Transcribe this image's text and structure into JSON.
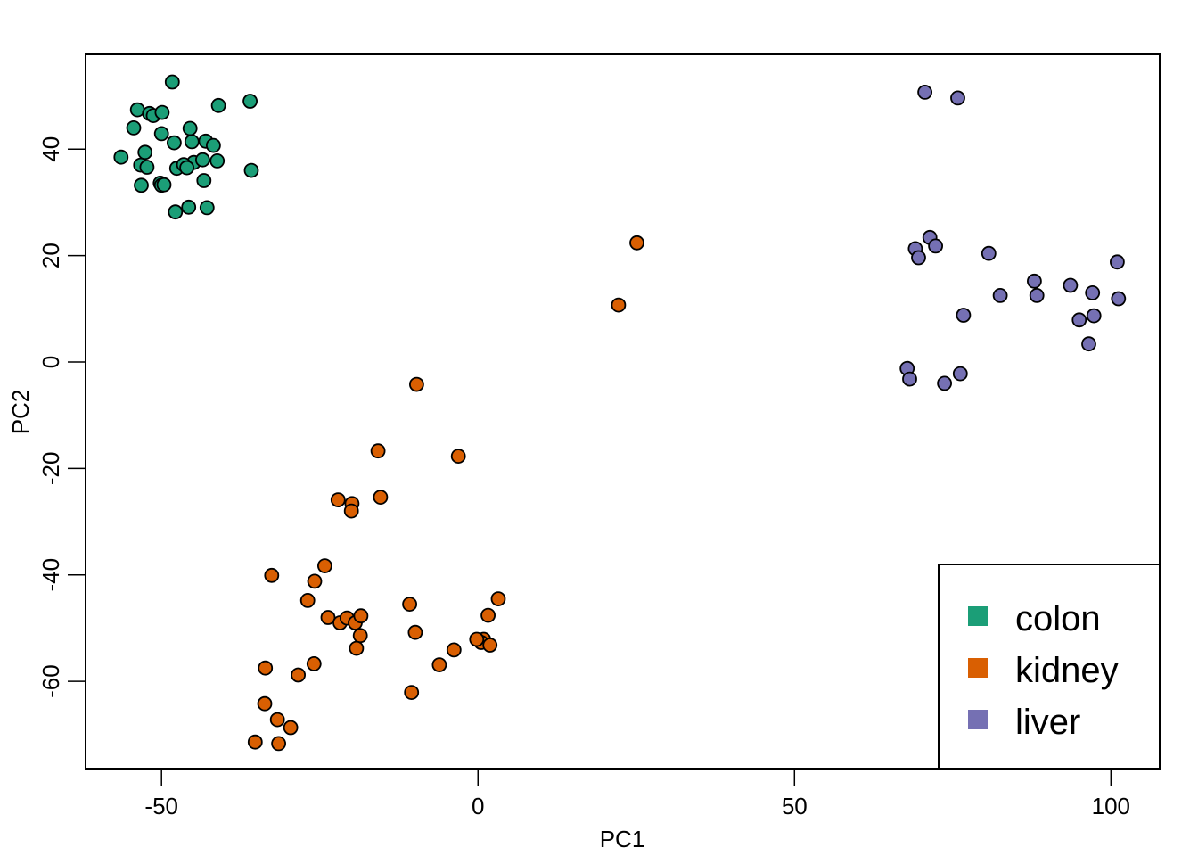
{
  "chart_data": {
    "type": "scatter",
    "title": "",
    "xlabel": "PC1",
    "ylabel": "PC2",
    "xlim": [
      -62.0,
      107.7
    ],
    "ylim": [
      -76.4,
      57.8
    ],
    "xticks": [
      -50,
      0,
      50,
      100
    ],
    "xtick_labels": [
      "-50",
      "0",
      "50",
      "100"
    ],
    "yticks": [
      -60,
      -40,
      -20,
      0,
      20,
      40
    ],
    "ytick_labels": [
      "-60",
      "-40",
      "-20",
      "0",
      "20",
      "40"
    ],
    "grid": false,
    "legend": {
      "position": "bottom-right",
      "entries": [
        "colon",
        "kidney",
        "liver"
      ]
    },
    "series": [
      {
        "name": "colon",
        "color": "#1B9E77",
        "points": [
          [
            -48.3,
            52.6
          ],
          [
            -36.0,
            49.0
          ],
          [
            -41.0,
            48.2
          ],
          [
            -53.8,
            47.4
          ],
          [
            -51.9,
            46.7
          ],
          [
            -51.3,
            46.3
          ],
          [
            -49.9,
            46.9
          ],
          [
            -54.4,
            44.0
          ],
          [
            -45.5,
            43.9
          ],
          [
            -50.0,
            42.9
          ],
          [
            -48.0,
            41.2
          ],
          [
            -45.2,
            41.4
          ],
          [
            -43.0,
            41.5
          ],
          [
            -41.8,
            40.7
          ],
          [
            -52.6,
            39.4
          ],
          [
            -56.4,
            38.5
          ],
          [
            -44.9,
            37.5
          ],
          [
            -43.5,
            38.0
          ],
          [
            -41.2,
            37.8
          ],
          [
            -53.3,
            37.0
          ],
          [
            -52.3,
            36.6
          ],
          [
            -47.6,
            36.4
          ],
          [
            -46.5,
            37.1
          ],
          [
            -46.0,
            36.5
          ],
          [
            -35.8,
            36.0
          ],
          [
            -43.3,
            34.1
          ],
          [
            -53.2,
            33.2
          ],
          [
            -50.2,
            33.6
          ],
          [
            -50.0,
            33.2
          ],
          [
            -49.6,
            33.3
          ],
          [
            -45.7,
            29.1
          ],
          [
            -42.8,
            29.0
          ],
          [
            -47.8,
            28.2
          ]
        ]
      },
      {
        "name": "kidney",
        "color": "#D95F02",
        "points": [
          [
            25.1,
            22.4
          ],
          [
            22.2,
            10.7
          ],
          [
            -9.7,
            -4.2
          ],
          [
            -15.8,
            -16.7
          ],
          [
            -3.1,
            -17.7
          ],
          [
            -22.1,
            -25.9
          ],
          [
            -19.9,
            -26.6
          ],
          [
            -20.0,
            -28.0
          ],
          [
            -15.4,
            -25.4
          ],
          [
            -32.6,
            -40.1
          ],
          [
            -24.2,
            -38.3
          ],
          [
            -25.8,
            -41.2
          ],
          [
            -26.9,
            -44.8
          ],
          [
            -23.7,
            -48.0
          ],
          [
            -21.8,
            -49.0
          ],
          [
            -20.7,
            -48.1
          ],
          [
            -19.4,
            -49.0
          ],
          [
            -18.5,
            -47.7
          ],
          [
            -18.6,
            -51.4
          ],
          [
            -19.2,
            -53.8
          ],
          [
            -10.8,
            -45.5
          ],
          [
            -9.9,
            -50.8
          ],
          [
            3.2,
            -44.5
          ],
          [
            1.6,
            -47.6
          ],
          [
            0.9,
            -52.1
          ],
          [
            0.5,
            -52.7
          ],
          [
            -0.2,
            -52.1
          ],
          [
            1.9,
            -53.2
          ],
          [
            -3.8,
            -54.1
          ],
          [
            -6.1,
            -56.9
          ],
          [
            -25.9,
            -56.7
          ],
          [
            -28.4,
            -58.8
          ],
          [
            -33.6,
            -57.5
          ],
          [
            -10.5,
            -62.1
          ],
          [
            -33.7,
            -64.2
          ],
          [
            -31.7,
            -67.2
          ],
          [
            -29.6,
            -68.7
          ],
          [
            -35.2,
            -71.4
          ],
          [
            -31.5,
            -71.7
          ]
        ]
      },
      {
        "name": "liver",
        "color": "#7570B3",
        "points": [
          [
            70.6,
            50.7
          ],
          [
            75.8,
            49.6
          ],
          [
            71.4,
            23.4
          ],
          [
            72.3,
            21.8
          ],
          [
            69.1,
            21.3
          ],
          [
            69.6,
            19.6
          ],
          [
            80.7,
            20.4
          ],
          [
            101.0,
            18.8
          ],
          [
            87.9,
            15.2
          ],
          [
            93.6,
            14.4
          ],
          [
            88.3,
            12.5
          ],
          [
            82.5,
            12.5
          ],
          [
            97.1,
            13.0
          ],
          [
            101.2,
            11.9
          ],
          [
            76.7,
            8.8
          ],
          [
            97.3,
            8.7
          ],
          [
            95.0,
            7.9
          ],
          [
            96.5,
            3.4
          ],
          [
            67.8,
            -1.2
          ],
          [
            68.2,
            -3.2
          ],
          [
            76.2,
            -2.2
          ],
          [
            73.7,
            -4.0
          ]
        ]
      }
    ]
  }
}
